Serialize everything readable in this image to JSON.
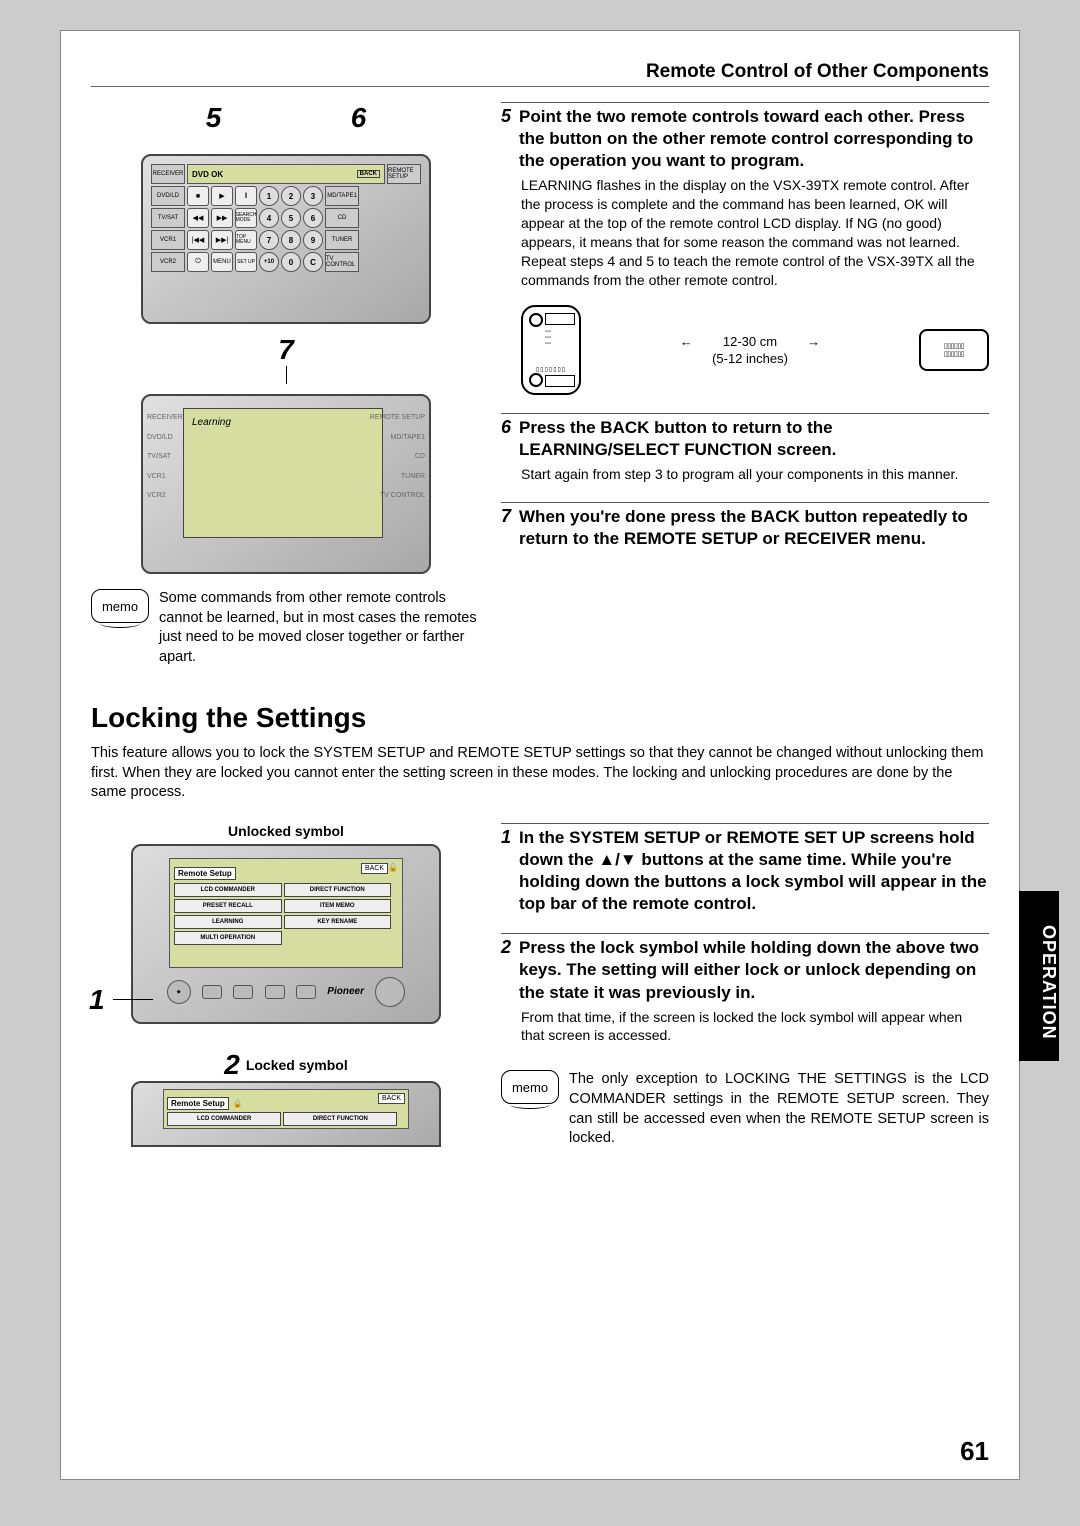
{
  "header": {
    "title": "Remote Control of Other Components"
  },
  "side_tab": "OPERATION",
  "page_number": "61",
  "figure_labels": {
    "five": "5",
    "six": "6",
    "seven": "7",
    "one_pointer": "1",
    "two_pointer": "2"
  },
  "remote_lcd_top": {
    "lcd_text": "DVD OK",
    "back": "BACK",
    "side_left": [
      "RECEIVER",
      "DVD/LD",
      "TV/SAT",
      "VCR1",
      "VCR2"
    ],
    "side_right": [
      "REMOTE SETUP",
      "MD/TAPE1",
      "CD",
      "TUNER",
      "TV CONTROL"
    ],
    "row2_labels": [
      "■",
      "▶",
      "‖",
      "1",
      "2",
      "3"
    ],
    "row3_labels": [
      "◀◀",
      "▶▶",
      "SEARCH MODE",
      "4",
      "5",
      "6"
    ],
    "row4_labels": [
      "|◀◀",
      "▶▶|",
      "TOP MENU",
      "7",
      "8",
      "9"
    ],
    "row5_labels": [
      "⏻",
      "MENU",
      "SET UP",
      "+10",
      "0",
      "C"
    ]
  },
  "remote_learning": {
    "lcd_text": "Learning",
    "side_left": [
      "RECEIVER",
      "DVD/LD",
      "TV/SAT",
      "VCR1",
      "VCR2"
    ],
    "side_right": [
      "REMOTE SETUP",
      "MD/TAPE1",
      "CD",
      "TUNER",
      "TV CONTROL"
    ]
  },
  "memo1": {
    "label": "memo",
    "text": "Some commands from other remote controls cannot be learned, but in most cases the remotes just need to be moved closer together or farther apart."
  },
  "step5": {
    "title": "Point the two remote controls toward each other. Press the button on the other remote control corresponding to the operation you want to program.",
    "body": "LEARNING flashes in the display on the VSX-39TX remote control. After the process is complete and the command has been learned, OK will appear at the top of the remote control LCD display. If NG (no good) appears, it means that for some reason the command was not learned. Repeat steps 4 and 5 to teach the remote control of the VSX-39TX all the commands from the other remote control."
  },
  "distance": {
    "cm": "12-30 cm",
    "inch": "(5-12 inches)"
  },
  "step6": {
    "title": "Press the BACK button to return to the LEARNING/SELECT FUNCTION screen.",
    "body": "Start again from step 3 to program all your components in this manner."
  },
  "step7": {
    "title": "When you're done press the BACK button repeatedly to return to the REMOTE SETUP or RECEIVER menu."
  },
  "section2": {
    "heading": "Locking the Settings",
    "intro": "This feature allows you to lock the SYSTEM SETUP and REMOTE SETUP settings so that they cannot be changed without unlocking them first. When they are locked you cannot enter the setting screen in these modes. The locking and unlocking procedures are done by the same process."
  },
  "unlocked": {
    "label": "Unlocked symbol",
    "screen_title": "Remote Setup",
    "back": "BACK",
    "cells": [
      "LCD COMMANDER",
      "DIRECT FUNCTION",
      "PRESET RECALL",
      "ITEM MEMO",
      "LEARNING",
      "KEY RENAME",
      "MULTI OPERATION"
    ],
    "brand": "Pioneer"
  },
  "locked": {
    "label": "Locked symbol",
    "screen_title": "Remote Setup",
    "back": "BACK",
    "cells": [
      "LCD COMMANDER",
      "DIRECT FUNCTION"
    ]
  },
  "lock_step1": {
    "title": "In the SYSTEM SETUP or REMOTE SET UP screens hold down the ▲/▼ buttons at the same time. While you're holding down the buttons a lock symbol will appear in the top bar of the remote control."
  },
  "lock_step2": {
    "title": "Press the lock symbol while holding down the above two keys. The setting will either lock or unlock depending on the state it was previously in.",
    "body": "From that time, if the screen is locked the lock symbol will appear when that screen is accessed."
  },
  "memo2": {
    "label": "memo",
    "text": "The only exception to LOCKING THE SETTINGS is the LCD COMMANDER settings in the REMOTE SETUP screen. They can still be accessed even when the REMOTE SETUP screen is locked."
  }
}
